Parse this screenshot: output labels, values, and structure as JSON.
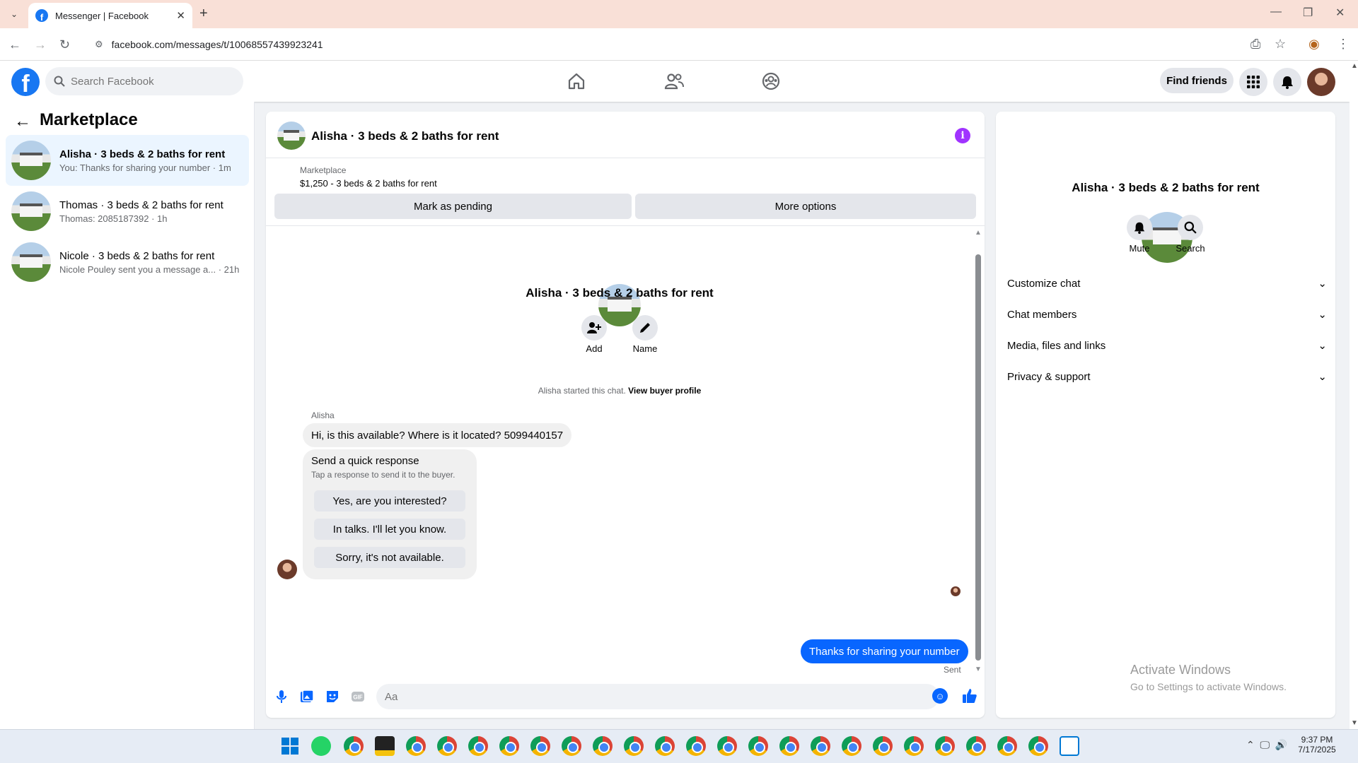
{
  "browser": {
    "tab_title": "Messenger | Facebook",
    "url": "facebook.com/messages/t/10068557439923241"
  },
  "fb": {
    "search_placeholder": "Search Facebook",
    "find_friends": "Find friends"
  },
  "sidebar": {
    "title": "Marketplace",
    "conversations": [
      {
        "title": "Alisha · 3 beds & 2 baths for rent",
        "preview": "You: Thanks for sharing your number · 1m",
        "active": true
      },
      {
        "title": "Thomas · 3 beds & 2 baths for rent",
        "preview": "Thomas: 2085187392 · 1h",
        "active": false
      },
      {
        "title": "Nicole · 3 beds & 2 baths for rent",
        "preview": "Nicole Pouley sent you a message a...  · 21h",
        "active": false
      }
    ]
  },
  "chat": {
    "title": "Alisha · 3 beds & 2 baths for rent",
    "marketplace_label": "Marketplace",
    "listing": "$1,250 - 3 beds & 2 baths for rent",
    "mark_pending": "Mark as pending",
    "more_options": "More options",
    "center_title": "Alisha · 3 beds & 2 baths for rent",
    "add_label": "Add",
    "name_label": "Name",
    "started_text": "Alisha started this chat.",
    "view_buyer": "View buyer profile",
    "sender": "Alisha",
    "message1": "Hi, is this available? Where is it located? 5099440157",
    "quick_title": "Send a quick response",
    "quick_sub": "Tap a response to send it to the buyer.",
    "quick_responses": [
      "Yes, are you interested?",
      "In talks. I'll let you know.",
      "Sorry, it's not available."
    ],
    "my_message": "Thanks for sharing your number",
    "sent_status": "Sent",
    "composer_placeholder": "Aa"
  },
  "info_panel": {
    "title": "Alisha · 3 beds & 2 baths for rent",
    "mute": "Mute",
    "search": "Search",
    "sections": [
      "Customize chat",
      "Chat members",
      "Media, files and links",
      "Privacy & support"
    ]
  },
  "watermark": {
    "line1": "Activate Windows",
    "line2": "Go to Settings to activate Windows."
  },
  "taskbar": {
    "time": "9:37 PM",
    "date": "7/17/2025"
  },
  "colors": {
    "fb_blue": "#1877f2",
    "messenger_blue": "#0866ff",
    "info_purple": "#a033ff"
  }
}
